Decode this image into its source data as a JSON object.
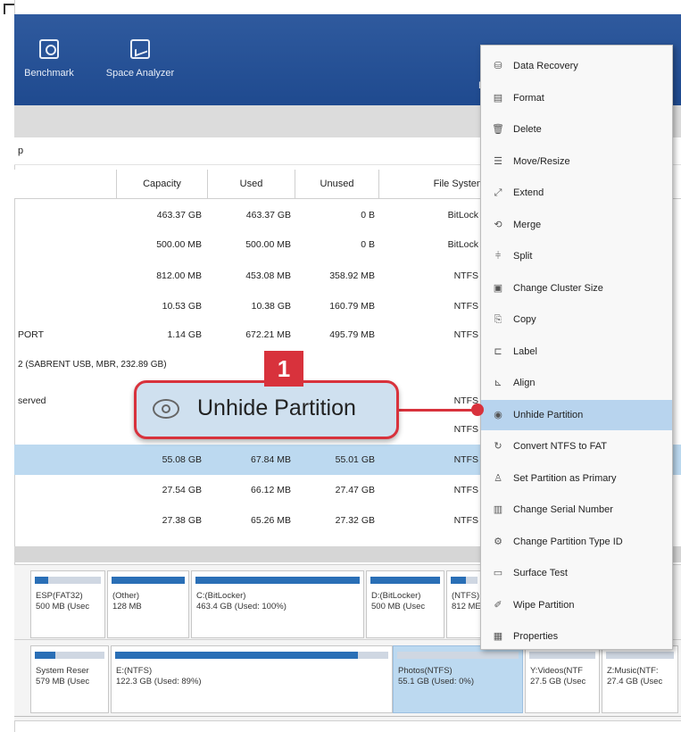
{
  "toolbar": {
    "items": [
      {
        "label": "Benchmark",
        "icon": "benchmark-icon"
      },
      {
        "label": "Space Analyzer",
        "icon": "space-analyzer-icon"
      }
    ],
    "clipped_label": "Bi"
  },
  "path": {
    "text": "p"
  },
  "table": {
    "headers": [
      "Capacity",
      "Used",
      "Unused",
      "File Systen"
    ],
    "rows": [
      {
        "name": "",
        "capacity": "463.37 GB",
        "used": "463.37 GB",
        "unused": "0 B",
        "fs": "BitLock"
      },
      {
        "name": "",
        "capacity": "500.00 MB",
        "used": "500.00 MB",
        "unused": "0 B",
        "fs": "BitLock"
      },
      {
        "name": "",
        "capacity": "812.00 MB",
        "used": "453.08 MB",
        "unused": "358.92 MB",
        "fs": "NTFS"
      },
      {
        "name": "",
        "capacity": "10.53 GB",
        "used": "10.38 GB",
        "unused": "160.79 MB",
        "fs": "NTFS"
      },
      {
        "name": "PORT",
        "capacity": "1.14 GB",
        "used": "672.21 MB",
        "unused": "495.79 MB",
        "fs": "NTFS"
      }
    ],
    "group_label": "2 (SABRENT USB, MBR, 232.89 GB)",
    "rows2": [
      {
        "name": "served",
        "capacity": "",
        "used": "",
        "unused": "",
        "fs": "NTFS"
      },
      {
        "name": "",
        "capacity": "",
        "used": "",
        "unused": "",
        "fs": "NTFS"
      },
      {
        "name": "",
        "capacity": "55.08 GB",
        "used": "67.84 MB",
        "unused": "55.01 GB",
        "fs": "NTFS"
      },
      {
        "name": "",
        "capacity": "27.54 GB",
        "used": "66.12 MB",
        "unused": "27.47 GB",
        "fs": "NTFS"
      },
      {
        "name": "",
        "capacity": "27.38 GB",
        "used": "65.26 MB",
        "unused": "27.32 GB",
        "fs": "NTFS"
      }
    ]
  },
  "disk1": {
    "partitions": [
      {
        "line1": "ESP(FAT32)",
        "line2": "500 MB (Usec",
        "fill_percent": 20
      },
      {
        "line1": "(Other)",
        "line2": "128 MB",
        "fill_percent": 100
      },
      {
        "line1": "C:(BitLocker)",
        "line2": "463.4 GB (Used: 100%)",
        "fill_percent": 100
      },
      {
        "line1": "D:(BitLocker)",
        "line2": "500 MB (Usec",
        "fill_percent": 100
      },
      {
        "line1": "(NTFS)",
        "line2": "812 ME",
        "fill_percent": 56
      }
    ]
  },
  "disk2": {
    "partitions": [
      {
        "line1": "System Reser",
        "line2": "579 MB (Usec",
        "fill_percent": 30
      },
      {
        "line1": "E:(NTFS)",
        "line2": "122.3 GB (Used: 89%)",
        "fill_percent": 89
      },
      {
        "line1": "Photos(NTFS)",
        "line2": "55.1 GB (Used: 0%)",
        "fill_percent": 0
      },
      {
        "line1": "Y:Videos(NTF",
        "line2": "27.5 GB (Usec",
        "fill_percent": 0
      },
      {
        "line1": "Z:Music(NTF:",
        "line2": "27.4 GB (Usec",
        "fill_percent": 0
      }
    ]
  },
  "context_menu": {
    "items": [
      {
        "label": "Data Recovery",
        "icon": "data-recovery-icon",
        "glyph": "⛁"
      },
      {
        "label": "Format",
        "icon": "format-icon",
        "glyph": "▤"
      },
      {
        "label": "Delete",
        "icon": "delete-icon",
        "glyph": "🗑"
      },
      {
        "label": "Move/Resize",
        "icon": "move-resize-icon",
        "glyph": "☰"
      },
      {
        "label": "Extend",
        "icon": "extend-icon",
        "glyph": "⤢"
      },
      {
        "label": "Merge",
        "icon": "merge-icon",
        "glyph": "⟲"
      },
      {
        "label": "Split",
        "icon": "split-icon",
        "glyph": "⫩"
      },
      {
        "label": "Change Cluster Size",
        "icon": "cluster-size-icon",
        "glyph": "▣"
      },
      {
        "label": "Copy",
        "icon": "copy-icon",
        "glyph": "⎘"
      },
      {
        "label": "Label",
        "icon": "label-icon",
        "glyph": "⊏"
      },
      {
        "label": "Align",
        "icon": "align-icon",
        "glyph": "⊾"
      },
      {
        "label": "Unhide Partition",
        "icon": "unhide-icon",
        "glyph": "◉",
        "highlighted": true
      },
      {
        "label": "Convert NTFS to FAT",
        "icon": "convert-icon",
        "glyph": "↻"
      },
      {
        "label": "Set Partition as Primary",
        "icon": "set-primary-icon",
        "glyph": "♙"
      },
      {
        "label": "Change Serial Number",
        "icon": "serial-icon",
        "glyph": "▥"
      },
      {
        "label": "Change Partition Type ID",
        "icon": "type-id-icon",
        "glyph": "⚙"
      },
      {
        "label": "Surface Test",
        "icon": "surface-test-icon",
        "glyph": "▭"
      },
      {
        "label": "Wipe Partition",
        "icon": "wipe-icon",
        "glyph": "✐"
      },
      {
        "label": "Properties",
        "icon": "properties-icon",
        "glyph": "▦"
      }
    ]
  },
  "callout": {
    "badge": "1",
    "label": "Unhide Partition",
    "icon": "eye-icon"
  },
  "colors": {
    "accent": "#d8323c",
    "toolbar": "#1f4a8f",
    "selection": "#bcd9f0"
  }
}
